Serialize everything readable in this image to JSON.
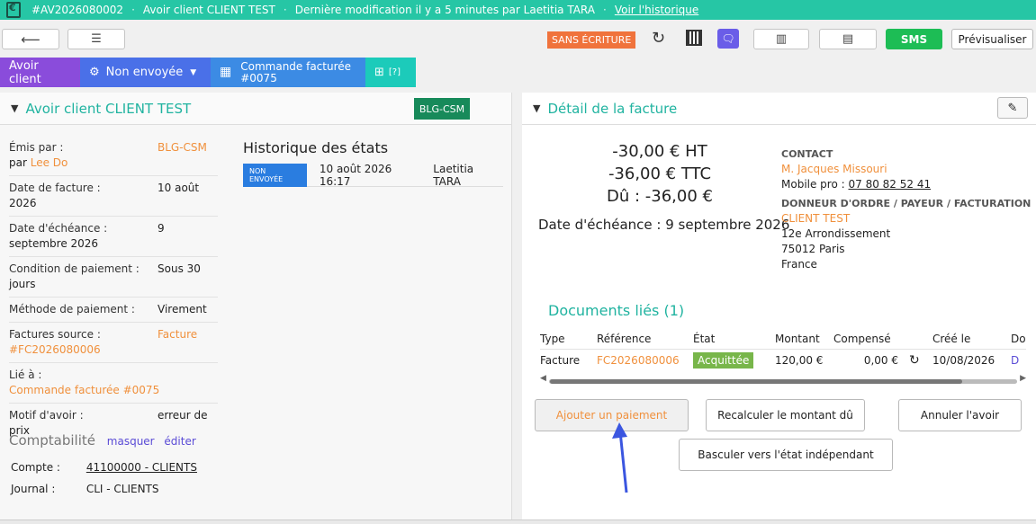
{
  "topbar": {
    "ref": "#AV2026080002",
    "title": "Avoir client CLIENT TEST",
    "modified": "Dernière modification il y a 5 minutes par Laetitia TARA",
    "history_link": "Voir l'historique"
  },
  "toolbar": {
    "tag": "SANS ÉCRITURE",
    "sms_label": "SMS",
    "preview_label": "Prévisualiser"
  },
  "tabs": {
    "avoir": "Avoir client",
    "status": "Non envoyée",
    "order": "Commande facturée #0075",
    "grid_suffix": "[?]"
  },
  "left": {
    "title": "Avoir client CLIENT TEST",
    "badge": "BLG-CSM",
    "fields": [
      {
        "k": "Émis par :",
        "k2": "par",
        "v": "BLG-CSM",
        "by": "Lee Do"
      },
      {
        "k": "Date de facture :",
        "v": "10 août",
        "v2": "2026"
      },
      {
        "k": "Date d'échéance :",
        "v": "9",
        "v2": "septembre 2026"
      },
      {
        "k": "Condition de paiement :",
        "v": "Sous 30",
        "v2": "jours"
      },
      {
        "k": "Méthode de paiement :",
        "v": "Virement"
      },
      {
        "k": "Factures source :",
        "v": "Facture",
        "v2": "#FC2026080006"
      },
      {
        "k": "Lié à :",
        "v2": "Commande facturée #0075"
      },
      {
        "k": "Motif d'avoir :",
        "v": "erreur de",
        "v2": "prix"
      }
    ],
    "history_title": "Historique des états",
    "history_row": {
      "badge": "NON ENVOYÉE",
      "date": "10 août 2026 16:17",
      "user": "Laetitia TARA"
    },
    "compta": {
      "title": "Comptabilité",
      "hide": "masquer",
      "edit": "éditer",
      "account_label": "Compte :",
      "account_value": "41100000 - CLIENTS",
      "journal_label": "Journal :",
      "journal_value": "CLI - CLIENTS"
    }
  },
  "right": {
    "title": "Détail de la facture",
    "ht": "-30,00 € HT",
    "ttc": "-36,00 € TTC",
    "due": "Dû : -36,00 €",
    "due_date": "Date d'échéance : 9 septembre 2026",
    "contact_label": "CONTACT",
    "contact_name": "M. Jacques Missouri",
    "mobile_label": "Mobile pro :",
    "mobile": "07 80 82 52 41",
    "donneur_label": "DONNEUR D'ORDRE / PAYEUR / FACTURATION",
    "client": "CLIENT TEST",
    "addr1": "12e Arrondissement",
    "addr2": "75012 Paris",
    "addr3": "France",
    "docs_title": "Documents liés (1)",
    "table": {
      "headers": [
        "Type",
        "Référence",
        "État",
        "Montant",
        "Compensé",
        "",
        "Créé le",
        "Do"
      ],
      "row": [
        "Facture",
        "FC2026080006",
        "Acquittée",
        "120,00 €",
        "0,00 €",
        "",
        "10/08/2026",
        "D"
      ]
    },
    "btn_add_payment": "Ajouter un paiement",
    "btn_recalc": "Recalculer le montant dû",
    "btn_cancel": "Annuler l'avoir",
    "btn_switch": "Basculer vers l'état indépendant"
  }
}
